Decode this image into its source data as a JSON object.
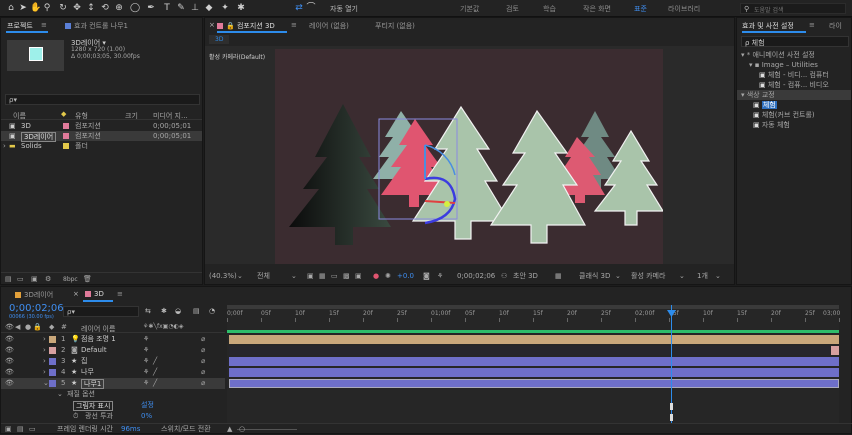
{
  "toolbar": {
    "snap_label": "자동 열기",
    "workspaces": [
      "기본값",
      "검토",
      "학습",
      "작은 화면",
      "표준",
      "라이브러리"
    ],
    "active_workspace": "표준",
    "search_placeholder": "도움말 검색"
  },
  "project_panel": {
    "tab_project": "프로젝트",
    "tab_effect_controls": "효과 컨트롤 나무1",
    "comp_name": "3D레이어 ▾",
    "comp_info_1": "1280 x 720 (1.00)",
    "comp_info_2": "Δ 0;00;03;05, 30.00fps",
    "search_placeholder": "ρ▾",
    "col_name": "이름",
    "col_type": "유형",
    "col_size": "크기",
    "col_media": "미디어 지...",
    "items": [
      {
        "name": "3D",
        "type": "컴포지션",
        "media": "0;00;05;01",
        "color": "#e07a9a"
      },
      {
        "name": "3D레이어",
        "type": "컴포지션",
        "media": "0;00;05;01",
        "color": "#e07a9a"
      },
      {
        "name": "Solids",
        "type": "폴더",
        "media": "",
        "color": "#e2c84a"
      }
    ],
    "bpc": "8bpc"
  },
  "comp_panel": {
    "tab_label": "컴포지션 3D",
    "tab_layer": "레이어 (없음)",
    "tab_footage": "푸티지 (없음)",
    "breadcrumb": "3D",
    "camera_label": "활성 카메라(Default)",
    "zoom": "(40.3%)",
    "resolution": "전체",
    "exposure": "+0.0",
    "timecode": "0;00;02;06",
    "draft_3d": "초안 3D",
    "renderer": "클래식 3D",
    "view": "활성 카메라",
    "views_count": "1개"
  },
  "effects_panel": {
    "tab_label": "효과 및 사전 설정",
    "tab_library": "라이",
    "search_value": "ρ 체험",
    "tree": [
      "▾ * 애니메이션 사전 설정",
      "▾ ▪ Image – Utilities",
      "체험 - 비디... 컴퓨터",
      "체험 - 컴퓨... 비디오",
      "▾ 색상 교정",
      "체험",
      "체험(커브 컨트롤)",
      "자동 체험"
    ]
  },
  "timeline": {
    "tab1": "3D레이어",
    "tab2": "3D",
    "timecode": "0;00;02;06",
    "timecode_sub": "00066 (30.00 fps)",
    "search_placeholder": "ρ▾",
    "col_layer_name": "레이어 이름",
    "ruler_ticks": [
      "0;00f",
      "05f",
      "10f",
      "15f",
      "20f",
      "25f",
      "01;00f",
      "05f",
      "10f",
      "15f",
      "20f",
      "25f",
      "02;00f",
      "05f",
      "10f",
      "15f",
      "20f",
      "25f",
      "03;00"
    ],
    "layers": [
      {
        "num": "1",
        "name": "점음 조명 1",
        "color": "#c9a77a"
      },
      {
        "num": "2",
        "name": "Default",
        "color": "#d7a0a0"
      },
      {
        "num": "3",
        "name": "집",
        "color": "#6e6fc9"
      },
      {
        "num": "4",
        "name": "나무",
        "color": "#6e6fc9"
      },
      {
        "num": "5",
        "name": "나무1",
        "color": "#6e6fc9"
      }
    ],
    "subsection": "재질 옵션",
    "prop1_label": "그림자 표시",
    "prop1_value": "설정",
    "prop2_label": "광선 투과",
    "prop2_value": "0%",
    "footer_label": "프레임 렌더링 시간",
    "footer_ms": "96ms",
    "footer_toggle": "스위치/모드 전환"
  },
  "colors": {
    "accent": "#2d8ceb",
    "layer_tan": "#c9a77a",
    "layer_blue": "#6e6fc9",
    "comp_bg": "#3b2c30"
  }
}
